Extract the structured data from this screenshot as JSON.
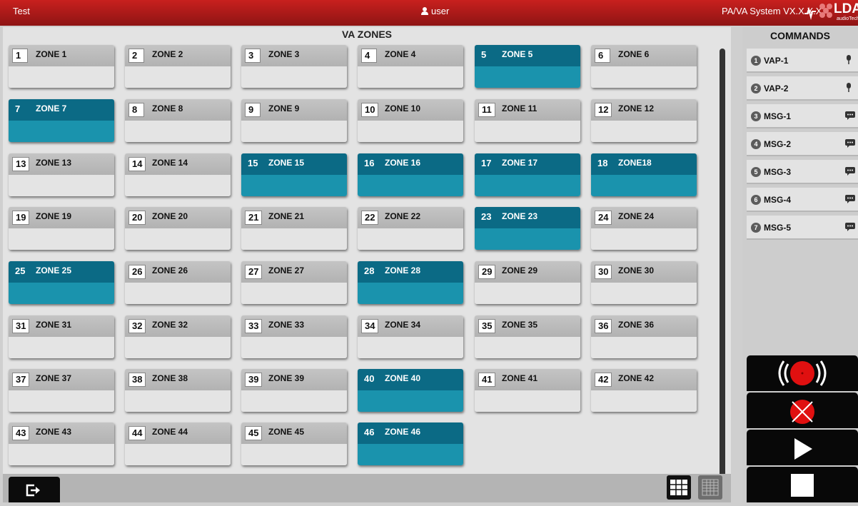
{
  "header": {
    "title": "Test",
    "user": "user",
    "system": "PA/VA System VX.X.X.X",
    "logo_text": "LDA",
    "logo_sub": "audioTech"
  },
  "va_title": "VA ZONES",
  "zones": [
    {
      "num": "1",
      "name": "ZONE 1",
      "active": false
    },
    {
      "num": "2",
      "name": "ZONE 2",
      "active": false
    },
    {
      "num": "3",
      "name": "ZONE 3",
      "active": false
    },
    {
      "num": "4",
      "name": "ZONE 4",
      "active": false
    },
    {
      "num": "5",
      "name": "ZONE 5",
      "active": true
    },
    {
      "num": "6",
      "name": "ZONE 6",
      "active": false
    },
    {
      "num": "7",
      "name": "ZONE 7",
      "active": true
    },
    {
      "num": "8",
      "name": "ZONE 8",
      "active": false
    },
    {
      "num": "9",
      "name": "ZONE 9",
      "active": false
    },
    {
      "num": "10",
      "name": "ZONE 10",
      "active": false
    },
    {
      "num": "11",
      "name": "ZONE 11",
      "active": false
    },
    {
      "num": "12",
      "name": "ZONE 12",
      "active": false
    },
    {
      "num": "13",
      "name": "ZONE 13",
      "active": false
    },
    {
      "num": "14",
      "name": "ZONE 14",
      "active": false
    },
    {
      "num": "15",
      "name": "ZONE 15",
      "active": true
    },
    {
      "num": "16",
      "name": "ZONE 16",
      "active": true
    },
    {
      "num": "17",
      "name": "ZONE 17",
      "active": true
    },
    {
      "num": "18",
      "name": "ZONE18",
      "active": true
    },
    {
      "num": "19",
      "name": "ZONE 19",
      "active": false
    },
    {
      "num": "20",
      "name": "ZONE 20",
      "active": false
    },
    {
      "num": "21",
      "name": "ZONE 21",
      "active": false
    },
    {
      "num": "22",
      "name": "ZONE 22",
      "active": false
    },
    {
      "num": "23",
      "name": "ZONE 23",
      "active": true
    },
    {
      "num": "24",
      "name": "ZONE 24",
      "active": false
    },
    {
      "num": "25",
      "name": "ZONE 25",
      "active": true
    },
    {
      "num": "26",
      "name": "ZONE 26",
      "active": false
    },
    {
      "num": "27",
      "name": "ZONE 27",
      "active": false
    },
    {
      "num": "28",
      "name": "ZONE 28",
      "active": true
    },
    {
      "num": "29",
      "name": "ZONE 29",
      "active": false
    },
    {
      "num": "30",
      "name": "ZONE 30",
      "active": false
    },
    {
      "num": "31",
      "name": "ZONE 31",
      "active": false
    },
    {
      "num": "32",
      "name": "ZONE 32",
      "active": false
    },
    {
      "num": "33",
      "name": "ZONE 33",
      "active": false
    },
    {
      "num": "34",
      "name": "ZONE 34",
      "active": false
    },
    {
      "num": "35",
      "name": "ZONE 35",
      "active": false
    },
    {
      "num": "36",
      "name": "ZONE 36",
      "active": false
    },
    {
      "num": "37",
      "name": "ZONE 37",
      "active": false
    },
    {
      "num": "38",
      "name": "ZONE 38",
      "active": false
    },
    {
      "num": "39",
      "name": "ZONE 39",
      "active": false
    },
    {
      "num": "40",
      "name": "ZONE 40",
      "active": true
    },
    {
      "num": "41",
      "name": "ZONE 41",
      "active": false
    },
    {
      "num": "42",
      "name": "ZONE 42",
      "active": false
    },
    {
      "num": "43",
      "name": "ZONE 43",
      "active": false
    },
    {
      "num": "44",
      "name": "ZONE 44",
      "active": false
    },
    {
      "num": "45",
      "name": "ZONE 45",
      "active": false
    },
    {
      "num": "46",
      "name": "ZONE 46",
      "active": true
    }
  ],
  "commands": {
    "title": "COMMANDS",
    "items": [
      {
        "num": "1",
        "label": "VAP-1",
        "icon": "microphone-icon"
      },
      {
        "num": "2",
        "label": "VAP-2",
        "icon": "microphone-icon"
      },
      {
        "num": "3",
        "label": "MSG-1",
        "icon": "message-icon"
      },
      {
        "num": "4",
        "label": "MSG-2",
        "icon": "message-icon"
      },
      {
        "num": "5",
        "label": "MSG-3",
        "icon": "message-icon"
      },
      {
        "num": "6",
        "label": "MSG-4",
        "icon": "message-icon"
      },
      {
        "num": "7",
        "label": "MSG-5",
        "icon": "message-icon"
      }
    ]
  },
  "action_buttons": [
    "emergency-alarm-icon",
    "cancel-icon",
    "play-icon",
    "stop-icon"
  ],
  "colors": {
    "header": "#b01a1a",
    "active_zone_top": "#0b6a85",
    "active_zone_bottom": "#1a93ad",
    "emergency": "#e01010"
  }
}
